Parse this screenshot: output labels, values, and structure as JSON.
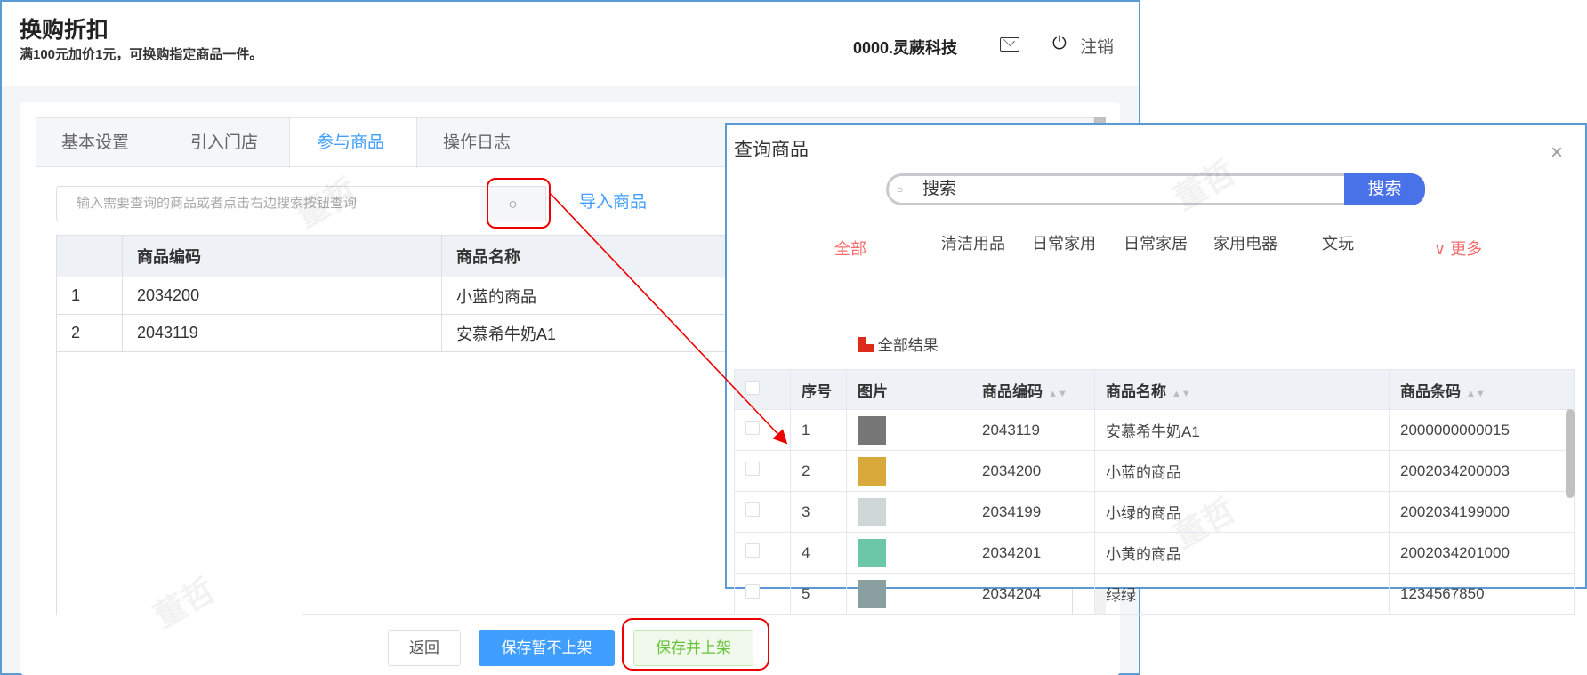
{
  "header": {
    "title": "换购折扣",
    "subtitle": "满100元加价1元，可换购指定商品一件。",
    "company": "0000.灵蕨科技",
    "logout": "注销"
  },
  "tabs": [
    {
      "label": "基本设置"
    },
    {
      "label": "引入门店"
    },
    {
      "label": "参与商品",
      "active": true
    },
    {
      "label": "操作日志"
    }
  ],
  "product_search": {
    "placeholder": "输入需要查询的商品或者点击右边搜索按钮查询",
    "import_label": "导入商品"
  },
  "products_table": {
    "columns": [
      "",
      "商品编码",
      "商品名称"
    ],
    "rows": [
      [
        "1",
        "2034200",
        "小蓝的商品"
      ],
      [
        "2",
        "2043119",
        "安慕希牛奶A1"
      ]
    ]
  },
  "footer": {
    "back": "返回",
    "save_unlisted": "保存暂不上架",
    "save_listed": "保存并上架"
  },
  "dialog": {
    "title": "查询商品",
    "search_placeholder": "搜索",
    "search_button": "搜索",
    "categories": [
      "全部",
      "清洁用品",
      "日常家用",
      "日常家居",
      "家用电器",
      "文玩"
    ],
    "more": "更多",
    "results_label": "全部结果",
    "columns": [
      "序号",
      "图片",
      "商品编码",
      "商品名称",
      "商品条码"
    ],
    "rows": [
      {
        "no": "1",
        "code": "2043119",
        "name": "安慕希牛奶A1",
        "barcode": "2000000000015",
        "img": "#777"
      },
      {
        "no": "2",
        "code": "2034200",
        "name": "小蓝的商品",
        "barcode": "2002034200003",
        "img": "#d8a83a"
      },
      {
        "no": "3",
        "code": "2034199",
        "name": "小绿的商品",
        "barcode": "2002034199000",
        "img": "#cfd8d8"
      },
      {
        "no": "4",
        "code": "2034201",
        "name": "小黄的商品",
        "barcode": "2002034201000",
        "img": "#6cc6a8"
      },
      {
        "no": "5",
        "code": "2034204",
        "name": "绿绿",
        "barcode": "1234567850",
        "img": "#8aa0a0"
      }
    ]
  },
  "watermark": "董哲",
  "colors": {
    "accent": "#409eff",
    "highlight": "#ee0000",
    "dialog_btn": "#4a72e8",
    "category_active": "#f56c6c"
  }
}
